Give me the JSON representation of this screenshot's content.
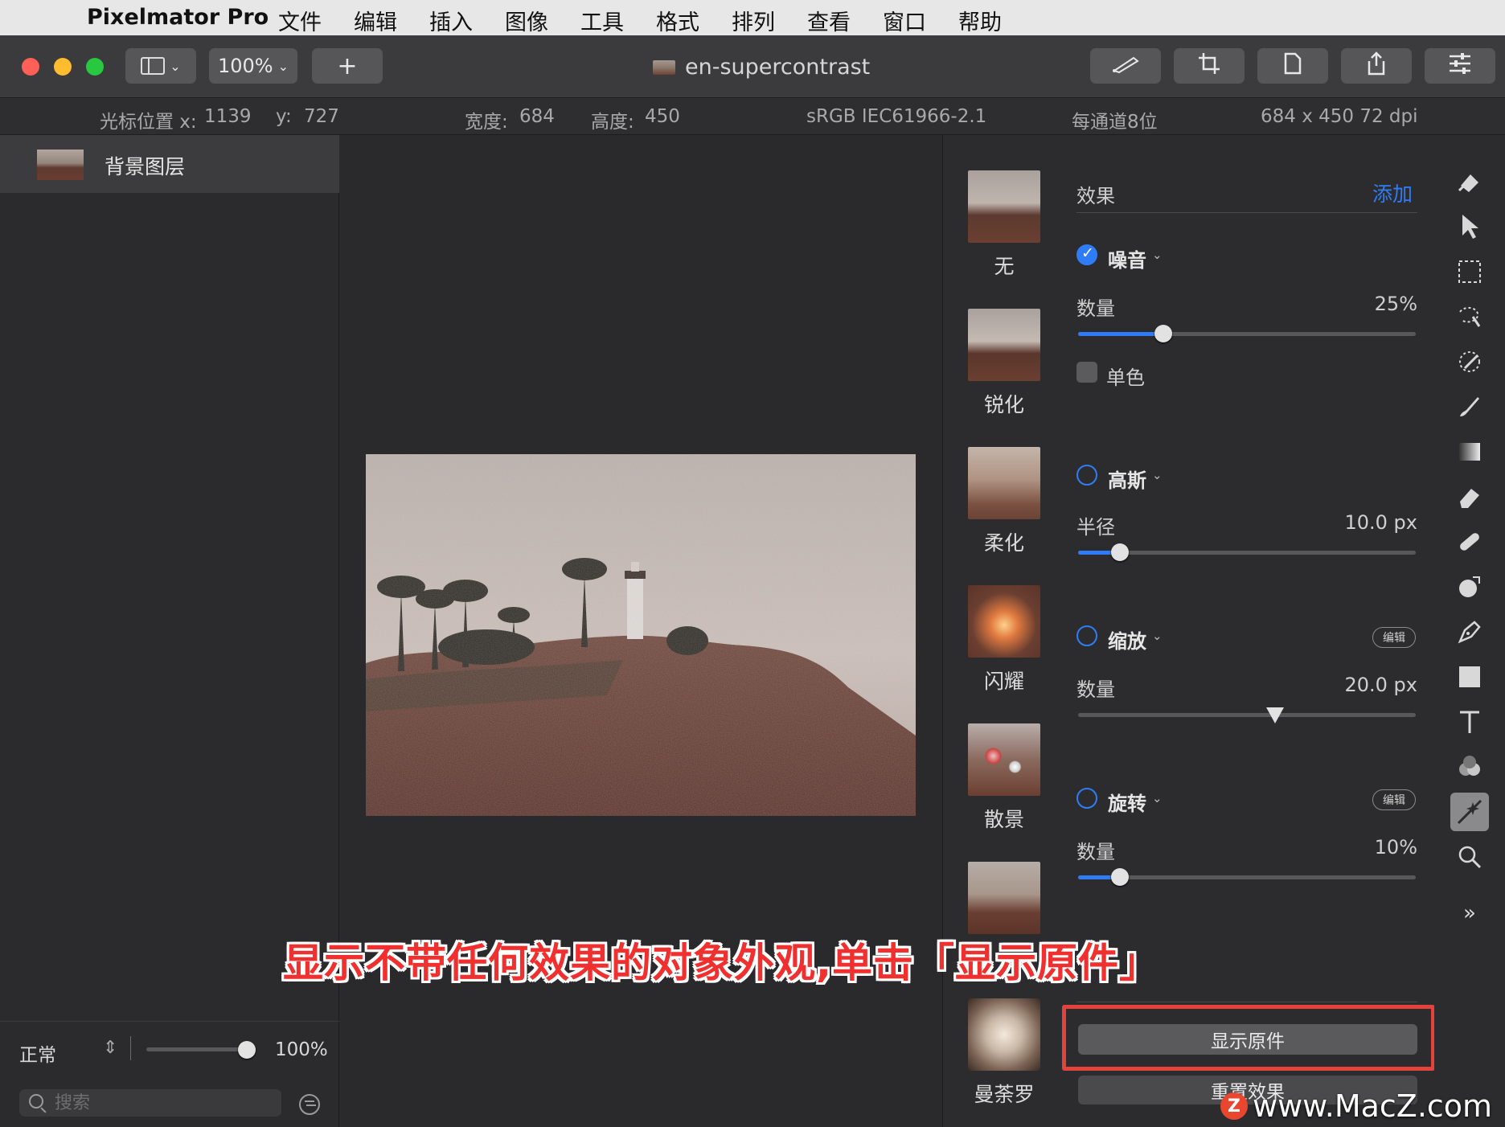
{
  "menubar": {
    "apple_icon": "apple-logo-icon",
    "app_name": "Pixelmator Pro",
    "items": [
      "文件",
      "编辑",
      "插入",
      "图像",
      "工具",
      "格式",
      "排列",
      "查看",
      "窗口",
      "帮助"
    ]
  },
  "toolbar": {
    "zoom": "100%",
    "add_label": "+",
    "document_title": "en-supercontrast",
    "traffic_lights": {
      "close": "#fe5f57",
      "minimize": "#febc2e",
      "zoom": "#28c840"
    }
  },
  "infobar": {
    "cursor_label": "光标位置 x:",
    "cursor_x": "1139",
    "y_label": "y:",
    "cursor_y": "727",
    "width_label": "宽度:",
    "width": "684",
    "height_label": "高度:",
    "height": "450",
    "color_profile": "sRGB IEC61966-2.1",
    "bit_depth": "每通道8位",
    "dimensions": "684 x 450 72 dpi"
  },
  "layers": {
    "items": [
      {
        "name": "背景图层"
      }
    ],
    "blend_mode": "正常",
    "opacity": "100%",
    "opacity_fraction": 1.0,
    "search_placeholder": "搜索"
  },
  "effects_browser": {
    "items": [
      {
        "label": "无"
      },
      {
        "label": "锐化"
      },
      {
        "label": "柔化"
      },
      {
        "label": "闪耀"
      },
      {
        "label": "散景"
      },
      {
        "label": ""
      },
      {
        "label": "曼荼罗"
      }
    ]
  },
  "effects_panel": {
    "header": "效果",
    "add_label": "添加",
    "edit_label": "编辑",
    "effects": [
      {
        "name": "噪音",
        "enabled": true,
        "param": "数量",
        "value": "25%",
        "fraction": 0.25,
        "checkbox_label": "单色"
      },
      {
        "name": "高斯",
        "enabled": false,
        "param": "半径",
        "value": "10.0 px",
        "fraction": 0.12
      },
      {
        "name": "缩放",
        "enabled": false,
        "param": "数量",
        "value": "20.0 px",
        "fraction": 0.59
      },
      {
        "name": "旋转",
        "enabled": false,
        "param": "数量",
        "value": "10%",
        "fraction": 0.12
      }
    ],
    "show_original": "显示原件",
    "reset_effects": "重置效果"
  },
  "accent_color": "#2f7df6",
  "caption": "显示不带任何效果的对象外观,单击「显示原件」",
  "watermark": "www.MacZ.com",
  "watermark_logo": "Z"
}
